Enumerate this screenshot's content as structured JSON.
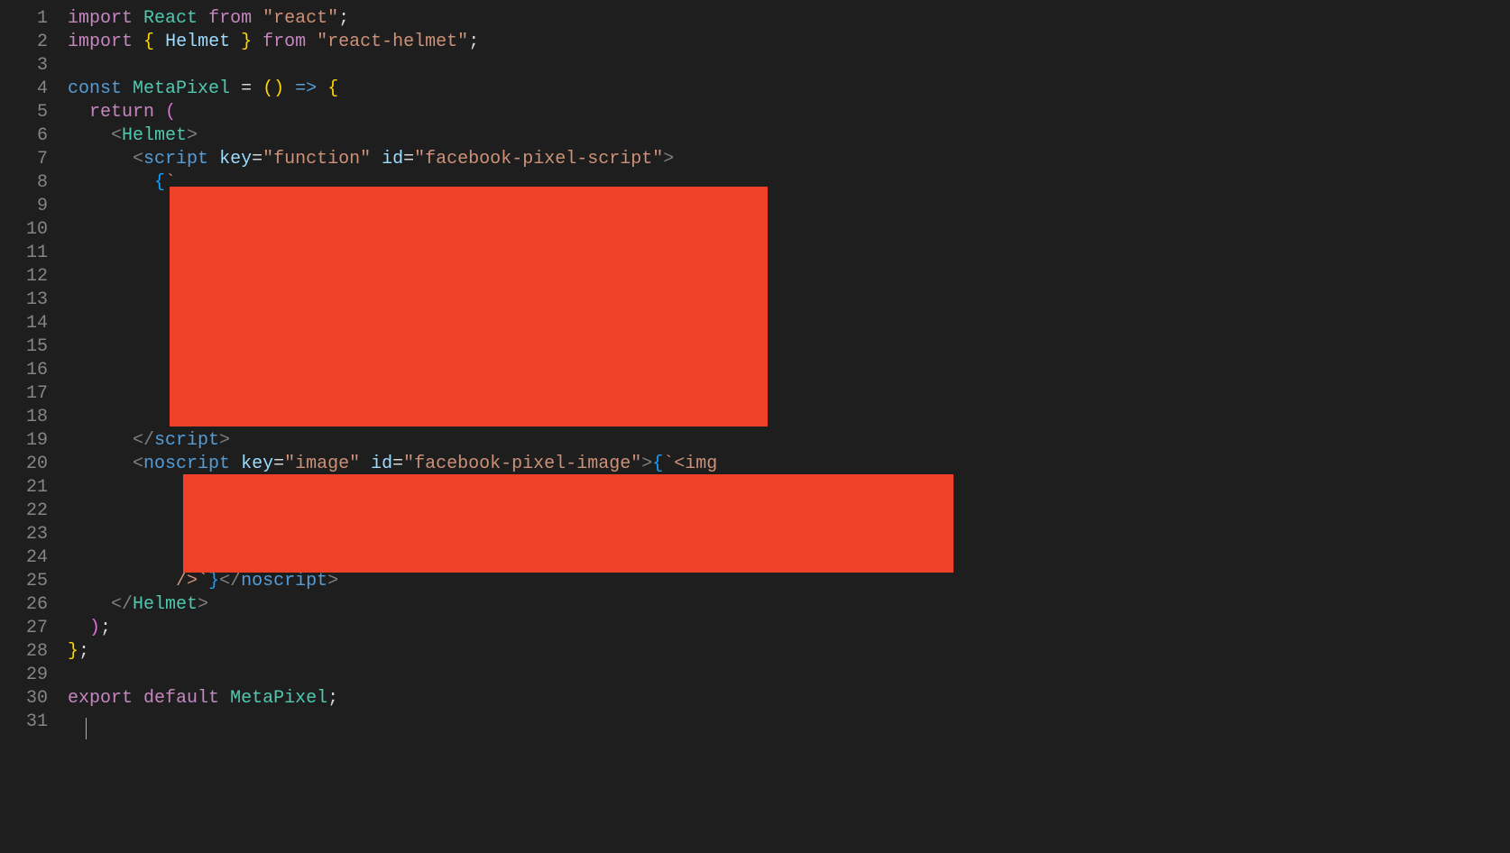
{
  "lineNumbers": [
    "1",
    "2",
    "3",
    "4",
    "5",
    "6",
    "7",
    "8",
    "9",
    "10",
    "11",
    "12",
    "13",
    "14",
    "15",
    "16",
    "17",
    "18",
    "19",
    "20",
    "21",
    "22",
    "23",
    "24",
    "25",
    "26",
    "27",
    "28",
    "29",
    "30",
    "31"
  ],
  "code": {
    "l1": {
      "import": "import",
      "react": "React",
      "from": "from",
      "str": "\"react\"",
      "semi": ";"
    },
    "l2": {
      "import": "import",
      "ob": "{",
      "helmet": "Helmet",
      "cb": "}",
      "from": "from",
      "str": "\"react-helmet\"",
      "semi": ";"
    },
    "l4": {
      "const": "const",
      "name": "MetaPixel",
      "eq": "=",
      "op": "(",
      "cp": ")",
      "arrow": "=>",
      "ob": "{"
    },
    "l5": {
      "return": "return",
      "op": "("
    },
    "l6": {
      "lt": "<",
      "helmet": "Helmet",
      "gt": ">"
    },
    "l7": {
      "lt": "<",
      "script": "script",
      "key": "key",
      "eq1": "=",
      "kv": "\"function\"",
      "id": "id",
      "eq2": "=",
      "idv": "\"facebook-pixel-script\"",
      "gt": ">"
    },
    "l8": {
      "ob": "{",
      "bt": "`"
    },
    "l19": {
      "lts": "</",
      "script": "script",
      "gt": ">"
    },
    "l20": {
      "lt": "<",
      "noscript": "noscript",
      "key": "key",
      "eq1": "=",
      "kv": "\"image\"",
      "id": "id",
      "eq2": "=",
      "idv": "\"facebook-pixel-image\"",
      "gt": ">",
      "ob": "{",
      "bt": "`",
      "lt2": "<",
      "img": "img"
    },
    "l25": {
      "slash": "/>",
      "bt": "`",
      "cb": "}",
      "lts": "</",
      "noscript": "noscript",
      "gt": ">"
    },
    "l26": {
      "lts": "</",
      "helmet": "Helmet",
      "gt": ">"
    },
    "l27": {
      "cp": ")",
      "semi": ";"
    },
    "l28": {
      "cb": "}",
      "semi": ";"
    },
    "l30": {
      "export": "export",
      "default": "default",
      "name": "MetaPixel",
      "semi": ";"
    }
  },
  "redactions": [
    {
      "id": 1
    },
    {
      "id": 2
    }
  ],
  "domain": "Computer-Use"
}
